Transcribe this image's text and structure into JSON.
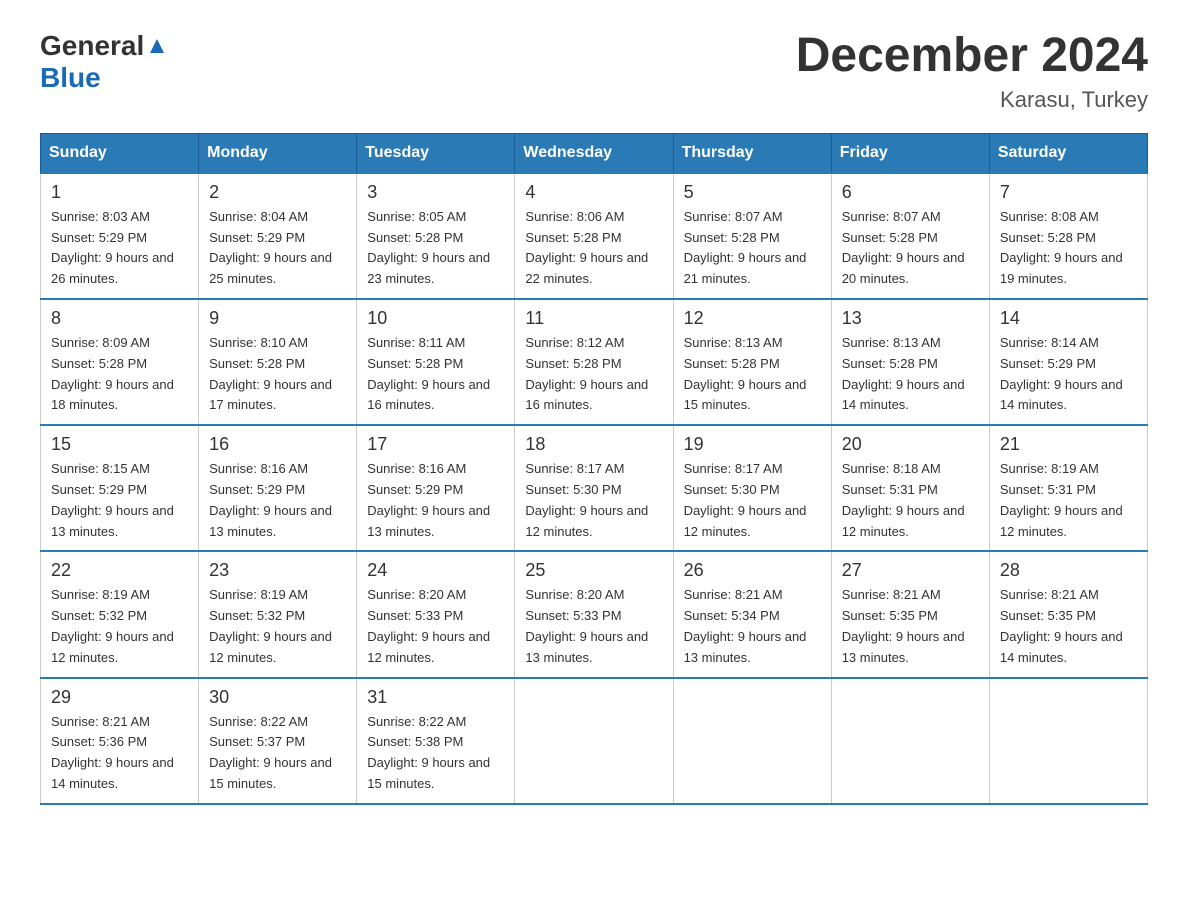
{
  "brand": {
    "name_general": "General",
    "name_blue": "Blue"
  },
  "title": "December 2024",
  "subtitle": "Karasu, Turkey",
  "days_of_week": [
    "Sunday",
    "Monday",
    "Tuesday",
    "Wednesday",
    "Thursday",
    "Friday",
    "Saturday"
  ],
  "weeks": [
    [
      {
        "day": "1",
        "sunrise": "8:03 AM",
        "sunset": "5:29 PM",
        "daylight": "9 hours and 26 minutes."
      },
      {
        "day": "2",
        "sunrise": "8:04 AM",
        "sunset": "5:29 PM",
        "daylight": "9 hours and 25 minutes."
      },
      {
        "day": "3",
        "sunrise": "8:05 AM",
        "sunset": "5:28 PM",
        "daylight": "9 hours and 23 minutes."
      },
      {
        "day": "4",
        "sunrise": "8:06 AM",
        "sunset": "5:28 PM",
        "daylight": "9 hours and 22 minutes."
      },
      {
        "day": "5",
        "sunrise": "8:07 AM",
        "sunset": "5:28 PM",
        "daylight": "9 hours and 21 minutes."
      },
      {
        "day": "6",
        "sunrise": "8:07 AM",
        "sunset": "5:28 PM",
        "daylight": "9 hours and 20 minutes."
      },
      {
        "day": "7",
        "sunrise": "8:08 AM",
        "sunset": "5:28 PM",
        "daylight": "9 hours and 19 minutes."
      }
    ],
    [
      {
        "day": "8",
        "sunrise": "8:09 AM",
        "sunset": "5:28 PM",
        "daylight": "9 hours and 18 minutes."
      },
      {
        "day": "9",
        "sunrise": "8:10 AM",
        "sunset": "5:28 PM",
        "daylight": "9 hours and 17 minutes."
      },
      {
        "day": "10",
        "sunrise": "8:11 AM",
        "sunset": "5:28 PM",
        "daylight": "9 hours and 16 minutes."
      },
      {
        "day": "11",
        "sunrise": "8:12 AM",
        "sunset": "5:28 PM",
        "daylight": "9 hours and 16 minutes."
      },
      {
        "day": "12",
        "sunrise": "8:13 AM",
        "sunset": "5:28 PM",
        "daylight": "9 hours and 15 minutes."
      },
      {
        "day": "13",
        "sunrise": "8:13 AM",
        "sunset": "5:28 PM",
        "daylight": "9 hours and 14 minutes."
      },
      {
        "day": "14",
        "sunrise": "8:14 AM",
        "sunset": "5:29 PM",
        "daylight": "9 hours and 14 minutes."
      }
    ],
    [
      {
        "day": "15",
        "sunrise": "8:15 AM",
        "sunset": "5:29 PM",
        "daylight": "9 hours and 13 minutes."
      },
      {
        "day": "16",
        "sunrise": "8:16 AM",
        "sunset": "5:29 PM",
        "daylight": "9 hours and 13 minutes."
      },
      {
        "day": "17",
        "sunrise": "8:16 AM",
        "sunset": "5:29 PM",
        "daylight": "9 hours and 13 minutes."
      },
      {
        "day": "18",
        "sunrise": "8:17 AM",
        "sunset": "5:30 PM",
        "daylight": "9 hours and 12 minutes."
      },
      {
        "day": "19",
        "sunrise": "8:17 AM",
        "sunset": "5:30 PM",
        "daylight": "9 hours and 12 minutes."
      },
      {
        "day": "20",
        "sunrise": "8:18 AM",
        "sunset": "5:31 PM",
        "daylight": "9 hours and 12 minutes."
      },
      {
        "day": "21",
        "sunrise": "8:19 AM",
        "sunset": "5:31 PM",
        "daylight": "9 hours and 12 minutes."
      }
    ],
    [
      {
        "day": "22",
        "sunrise": "8:19 AM",
        "sunset": "5:32 PM",
        "daylight": "9 hours and 12 minutes."
      },
      {
        "day": "23",
        "sunrise": "8:19 AM",
        "sunset": "5:32 PM",
        "daylight": "9 hours and 12 minutes."
      },
      {
        "day": "24",
        "sunrise": "8:20 AM",
        "sunset": "5:33 PM",
        "daylight": "9 hours and 12 minutes."
      },
      {
        "day": "25",
        "sunrise": "8:20 AM",
        "sunset": "5:33 PM",
        "daylight": "9 hours and 13 minutes."
      },
      {
        "day": "26",
        "sunrise": "8:21 AM",
        "sunset": "5:34 PM",
        "daylight": "9 hours and 13 minutes."
      },
      {
        "day": "27",
        "sunrise": "8:21 AM",
        "sunset": "5:35 PM",
        "daylight": "9 hours and 13 minutes."
      },
      {
        "day": "28",
        "sunrise": "8:21 AM",
        "sunset": "5:35 PM",
        "daylight": "9 hours and 14 minutes."
      }
    ],
    [
      {
        "day": "29",
        "sunrise": "8:21 AM",
        "sunset": "5:36 PM",
        "daylight": "9 hours and 14 minutes."
      },
      {
        "day": "30",
        "sunrise": "8:22 AM",
        "sunset": "5:37 PM",
        "daylight": "9 hours and 15 minutes."
      },
      {
        "day": "31",
        "sunrise": "8:22 AM",
        "sunset": "5:38 PM",
        "daylight": "9 hours and 15 minutes."
      },
      null,
      null,
      null,
      null
    ]
  ],
  "labels": {
    "sunrise": "Sunrise:",
    "sunset": "Sunset:",
    "daylight": "Daylight:"
  }
}
